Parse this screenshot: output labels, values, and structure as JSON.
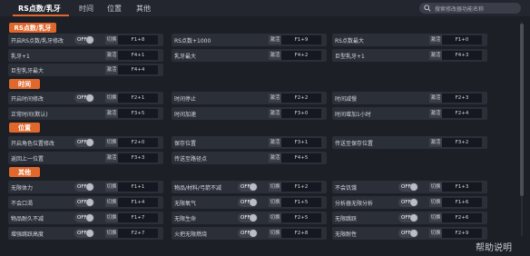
{
  "tabs": [
    {
      "label": "RS点数/乳牙"
    },
    {
      "label": "时间"
    },
    {
      "label": "位置"
    },
    {
      "label": "其他"
    }
  ],
  "search": {
    "placeholder": "搜索修改器功能名称"
  },
  "help": {
    "label": "帮助说明"
  },
  "sections": [
    {
      "title": "RS点数/乳牙",
      "rows": [
        {
          "label": "开启RS点数/乳牙修改",
          "toggle": "OFF",
          "action": "切换",
          "hotkey": "F1+8"
        },
        {
          "label": "RS点数+1000",
          "toggle": "",
          "action": "激活",
          "hotkey": "F1+9"
        },
        {
          "label": "RS点数最大",
          "toggle": "",
          "action": "激活",
          "hotkey": "F1+0"
        },
        {
          "label": "乳牙+1",
          "toggle": "",
          "action": "激活",
          "hotkey": "F4+1"
        },
        {
          "label": "乳牙最大",
          "toggle": "",
          "action": "激活",
          "hotkey": "F4+2"
        },
        {
          "label": "巨型乳牙+1",
          "toggle": "",
          "action": "激活",
          "hotkey": "F4+3"
        },
        {
          "label": "巨型乳牙最大",
          "toggle": "",
          "action": "激活",
          "hotkey": "F4+4"
        }
      ]
    },
    {
      "title": "时间",
      "rows": [
        {
          "label": "开启时间修改",
          "toggle": "OFF",
          "action": "切换",
          "hotkey": "F2+1"
        },
        {
          "label": "时间停止",
          "toggle": "",
          "action": "激活",
          "hotkey": "F2+2"
        },
        {
          "label": "时间减慢",
          "toggle": "",
          "action": "激活",
          "hotkey": "F2+3"
        },
        {
          "label": "正常时间(默认)",
          "toggle": "",
          "action": "激活",
          "hotkey": "F3+5"
        },
        {
          "label": "时间加速",
          "toggle": "",
          "action": "激活",
          "hotkey": "F3+0"
        },
        {
          "label": "时间增加1小时",
          "toggle": "",
          "action": "激活",
          "hotkey": "F2+4"
        }
      ]
    },
    {
      "title": "位置",
      "rows": [
        {
          "label": "开启角色位置修改",
          "toggle": "OFF",
          "action": "切换",
          "hotkey": "F2+0"
        },
        {
          "label": "保存位置",
          "toggle": "",
          "action": "激活",
          "hotkey": "F3+1"
        },
        {
          "label": "传送至保存位置",
          "toggle": "",
          "action": "激活",
          "hotkey": "F3+2"
        },
        {
          "label": "返回上一位置",
          "toggle": "",
          "action": "激活",
          "hotkey": "F3+3"
        },
        {
          "label": "传送至路径点",
          "toggle": "",
          "action": "激活",
          "hotkey": "F4+5"
        }
      ]
    },
    {
      "title": "其他",
      "rows": [
        {
          "label": "无限体力",
          "toggle": "OFF",
          "action": "切换",
          "hotkey": "F1+1"
        },
        {
          "label": "物品/材料/弓箭不减",
          "toggle": "OFF",
          "action": "切换",
          "hotkey": "F1+2"
        },
        {
          "label": "不会饥饿",
          "toggle": "OFF",
          "action": "切换",
          "hotkey": "F1+3"
        },
        {
          "label": "不会口渴",
          "toggle": "OFF",
          "action": "切换",
          "hotkey": "F1+4"
        },
        {
          "label": "无限氧气",
          "toggle": "OFF",
          "action": "切换",
          "hotkey": "F1+5"
        },
        {
          "label": "分析器无限分析",
          "toggle": "OFF",
          "action": "切换",
          "hotkey": "F1+6"
        },
        {
          "label": "物品耐久不减",
          "toggle": "OFF",
          "action": "切换",
          "hotkey": "F1+7"
        },
        {
          "label": "无限生命",
          "toggle": "OFF",
          "action": "切换",
          "hotkey": "F2+5"
        },
        {
          "label": "无限跳跃",
          "toggle": "OFF",
          "action": "切换",
          "hotkey": "F2+6"
        },
        {
          "label": "增强跳跃高度",
          "toggle": "OFF",
          "action": "切换",
          "hotkey": "F2+7"
        },
        {
          "label": "火把无限燃烧",
          "toggle": "OFF",
          "action": "切换",
          "hotkey": "F2+8"
        },
        {
          "label": "无限耐性",
          "toggle": "OFF",
          "action": "切换",
          "hotkey": "F2+9"
        }
      ]
    }
  ]
}
